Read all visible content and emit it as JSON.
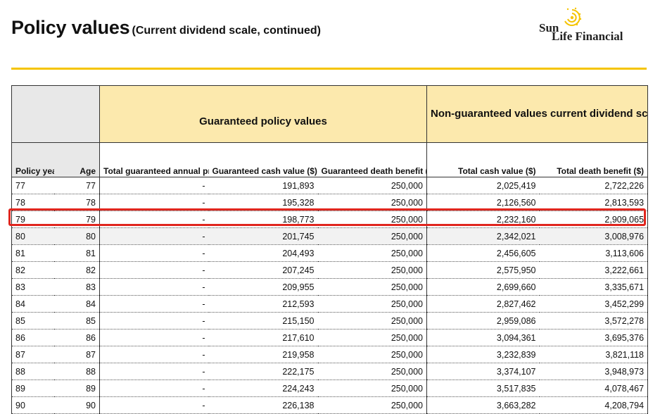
{
  "header": {
    "title": "Policy values",
    "subtitle": "(Current dividend scale, continued)"
  },
  "logo": {
    "line1": "Sun",
    "line2": "Life Financial",
    "accent_color": "#f5c400"
  },
  "table": {
    "group_headers": {
      "guaranteed": "Guaranteed policy values",
      "non_guaranteed": "Non-guaranteed values current dividend scale"
    },
    "columns": {
      "policy_year": "Policy year",
      "age": "Age",
      "premium": "Total guaranteed annual premium ($)",
      "cash_value": "Guaranteed cash value ($)",
      "death_benefit": "Guaranteed death benefit ($)",
      "total_cash": "Total cash value ($)",
      "total_death": "Total death benefit ($)"
    },
    "highlighted_row_index": 3,
    "highlight_color": "#e0261e",
    "rows": [
      {
        "year": "77",
        "age": "77",
        "premium": "-",
        "cash": "191,893",
        "death": "250,000",
        "tcash": "2,025,419",
        "tdeath": "2,722,226"
      },
      {
        "year": "78",
        "age": "78",
        "premium": "-",
        "cash": "195,328",
        "death": "250,000",
        "tcash": "2,126,560",
        "tdeath": "2,813,593"
      },
      {
        "year": "79",
        "age": "79",
        "premium": "-",
        "cash": "198,773",
        "death": "250,000",
        "tcash": "2,232,160",
        "tdeath": "2,909,065"
      },
      {
        "year": "80",
        "age": "80",
        "premium": "-",
        "cash": "201,745",
        "death": "250,000",
        "tcash": "2,342,021",
        "tdeath": "3,008,976"
      },
      {
        "year": "81",
        "age": "81",
        "premium": "-",
        "cash": "204,493",
        "death": "250,000",
        "tcash": "2,456,605",
        "tdeath": "3,113,606"
      },
      {
        "year": "82",
        "age": "82",
        "premium": "-",
        "cash": "207,245",
        "death": "250,000",
        "tcash": "2,575,950",
        "tdeath": "3,222,661"
      },
      {
        "year": "83",
        "age": "83",
        "premium": "-",
        "cash": "209,955",
        "death": "250,000",
        "tcash": "2,699,660",
        "tdeath": "3,335,671"
      },
      {
        "year": "84",
        "age": "84",
        "premium": "-",
        "cash": "212,593",
        "death": "250,000",
        "tcash": "2,827,462",
        "tdeath": "3,452,299"
      },
      {
        "year": "85",
        "age": "85",
        "premium": "-",
        "cash": "215,150",
        "death": "250,000",
        "tcash": "2,959,086",
        "tdeath": "3,572,278"
      },
      {
        "year": "86",
        "age": "86",
        "premium": "-",
        "cash": "217,610",
        "death": "250,000",
        "tcash": "3,094,361",
        "tdeath": "3,695,376"
      },
      {
        "year": "87",
        "age": "87",
        "premium": "-",
        "cash": "219,958",
        "death": "250,000",
        "tcash": "3,232,839",
        "tdeath": "3,821,118"
      },
      {
        "year": "88",
        "age": "88",
        "premium": "-",
        "cash": "222,175",
        "death": "250,000",
        "tcash": "3,374,107",
        "tdeath": "3,948,973"
      },
      {
        "year": "89",
        "age": "89",
        "premium": "-",
        "cash": "224,243",
        "death": "250,000",
        "tcash": "3,517,835",
        "tdeath": "4,078,467"
      },
      {
        "year": "90",
        "age": "90",
        "premium": "-",
        "cash": "226,138",
        "death": "250,000",
        "tcash": "3,663,282",
        "tdeath": "4,208,794"
      }
    ]
  }
}
